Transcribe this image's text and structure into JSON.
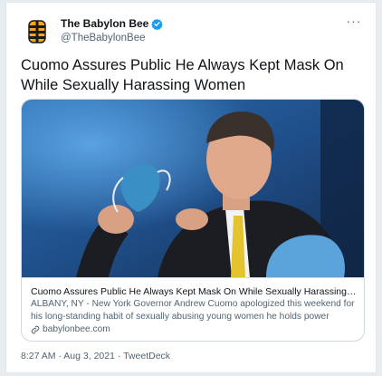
{
  "account": {
    "display_name": "The Babylon Bee",
    "handle": "@TheBabylonBee"
  },
  "more_label": "···",
  "tweet": {
    "text": "Cuomo Assures Public He Always Kept Mask On While Sexually Harassing Women"
  },
  "card": {
    "title": "Cuomo Assures Public He Always Kept Mask On While Sexually Harassing Wom...",
    "description": "ALBANY, NY - New York Governor Andrew Cuomo apologized this weekend for his long-standing habit of sexually abusing young women he holds power over...",
    "domain": "babylonbee.com"
  },
  "meta": {
    "time": "8:27 AM",
    "separator": "·",
    "date": "Aug 3, 2021",
    "source": "TweetDeck"
  },
  "colors": {
    "verified_badge": "#1d9bf0",
    "logo_yellow": "#f6a81c",
    "logo_black": "#1a1a1a",
    "mask_blue": "#3a8fc4",
    "background_blue": "#1f4f8a"
  },
  "icons": [
    "babylon-bee-logo",
    "verified-badge-icon",
    "more-icon",
    "link-icon"
  ]
}
